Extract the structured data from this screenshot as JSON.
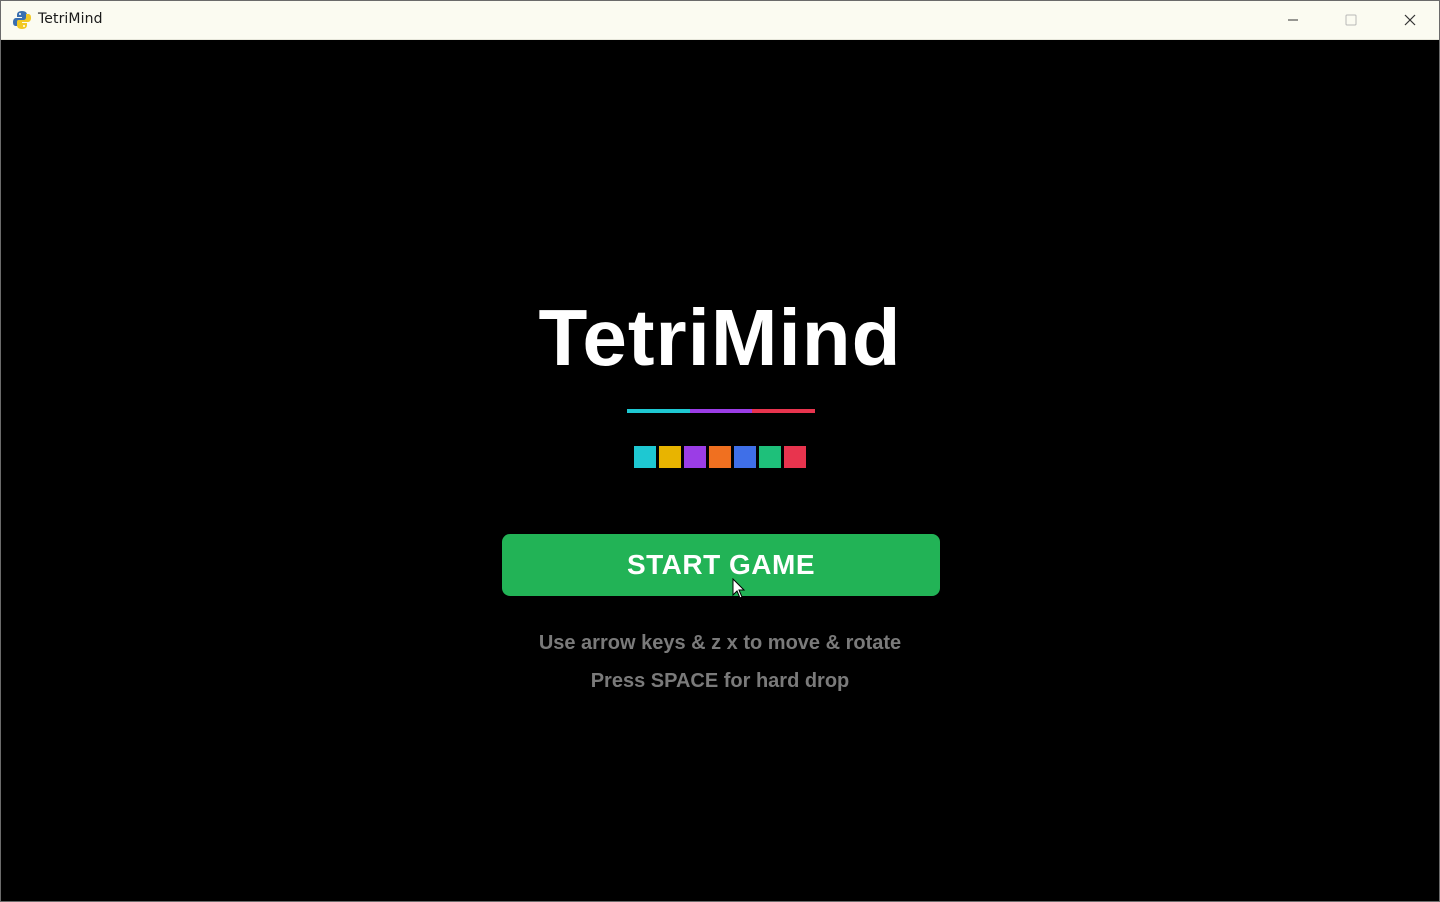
{
  "window": {
    "title": "TetriMind",
    "icon": "python-snake-icon"
  },
  "game": {
    "title": "TetriMind",
    "underline_colors": [
      "#1ec8d2",
      "#9b3de6",
      "#e8344e"
    ],
    "piece_colors": [
      "#1ec8d2",
      "#e8b400",
      "#9b3de6",
      "#f07020",
      "#3f6fe8",
      "#1ec07a",
      "#e8344e"
    ],
    "start_button_label": "START GAME",
    "hint_line_1": "Use arrow keys & z x to move & rotate",
    "hint_line_2": "Press SPACE for hard drop",
    "accent_color": "#22b356"
  }
}
